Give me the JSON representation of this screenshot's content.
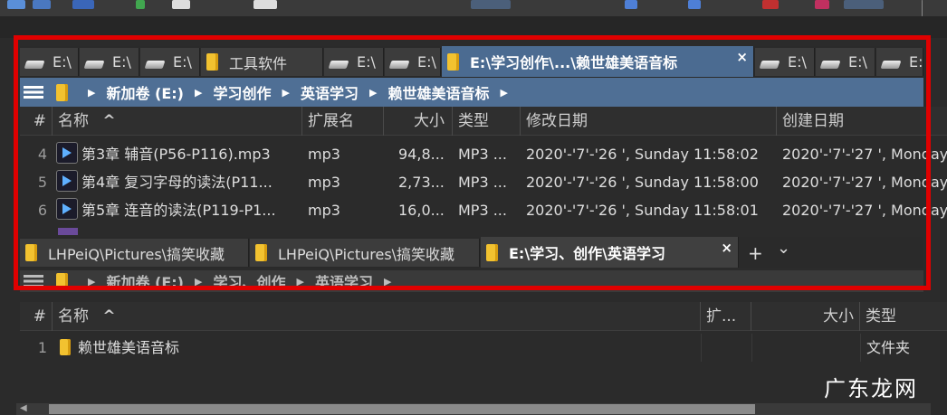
{
  "top_pane": {
    "tabs": [
      {
        "label": "E:\\",
        "icon": "drive-icon"
      },
      {
        "label": "E:\\",
        "icon": "drive-icon"
      },
      {
        "label": "E:\\",
        "icon": "drive-icon"
      },
      {
        "label": "工具软件",
        "icon": "folder-icon"
      },
      {
        "label": "E:\\",
        "icon": "drive-icon"
      },
      {
        "label": "E:\\",
        "icon": "drive-icon"
      },
      {
        "label": "E:\\学习创作\\...\\赖世雄美语音标",
        "icon": "folder-icon",
        "active": true,
        "close": "×"
      },
      {
        "label": "E:\\",
        "icon": "drive-icon"
      },
      {
        "label": "E:\\",
        "icon": "drive-icon"
      },
      {
        "label": "E:\\",
        "icon": "drive-icon"
      }
    ],
    "breadcrumb": [
      "新加卷 (E:)",
      "学习创作",
      "英语学习",
      "赖世雄美语音标"
    ],
    "columns": {
      "num": "#",
      "name": "名称",
      "ext": "扩展名",
      "size": "大小",
      "type": "类型",
      "modified": "修改日期",
      "created": "创建日期"
    },
    "rows": [
      {
        "num": "4",
        "name": "第3章 辅音(P56-P116).mp3",
        "ext": "mp3",
        "size": "94,8...",
        "type": "MP3 ...",
        "modified": "2020'-'7'-'26 ', Sunday 11:58:02",
        "created": "2020'-'7'-'27 ', Monday"
      },
      {
        "num": "5",
        "name": "第4章 复习字母的读法(P11...",
        "ext": "mp3",
        "size": "2,73...",
        "type": "MP3 ...",
        "modified": "2020'-'7'-'26 ', Sunday 11:58:00",
        "created": "2020'-'7'-'27 ', Monday"
      },
      {
        "num": "6",
        "name": "第5章 连音的读法(P119-P1...",
        "ext": "mp3",
        "size": "16,0...",
        "type": "MP3 ...",
        "modified": "2020'-'7'-'26 ', Sunday 11:58:01",
        "created": "2020'-'7'-'27 ', Monday"
      }
    ]
  },
  "bottom_pane": {
    "tabs": [
      {
        "label": "LHPeiQ\\Pictures\\搞笑收藏",
        "icon": "folder-icon"
      },
      {
        "label": "LHPeiQ\\Pictures\\搞笑收藏",
        "icon": "folder-icon"
      },
      {
        "label": "E:\\学习、创作\\英语学习",
        "icon": "folder-icon",
        "active": true,
        "close": "×"
      }
    ],
    "add_tab": "+",
    "dropdown": "⌄",
    "breadcrumb": [
      "新加卷 (E:)",
      "学习、创作",
      "英语学习"
    ],
    "columns": {
      "num": "#",
      "name": "名称",
      "ext": "扩...",
      "size": "大小",
      "type": "类型"
    },
    "rows": [
      {
        "num": "1",
        "name": "赖世雄美语音标",
        "ext": "",
        "size": "",
        "type": "文件夹"
      }
    ]
  },
  "sort_indicator": "^",
  "watermark": "广东龙网",
  "colors": {
    "highlight_frame": "#e00000",
    "active_tab": "#4b6b91",
    "breadcrumb_bar": "#4f6f95",
    "folder": "#f2c230"
  }
}
